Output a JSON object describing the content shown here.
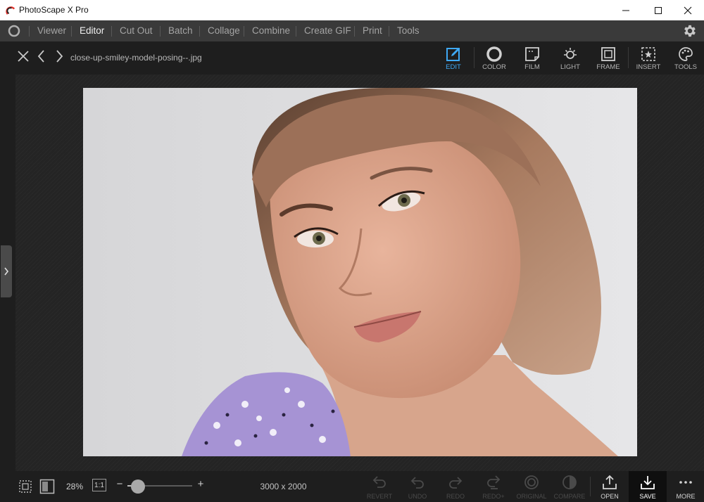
{
  "window": {
    "title": "PhotoScape X Pro",
    "controls": [
      "minimize-icon",
      "maximize-icon",
      "close-icon"
    ]
  },
  "menu": {
    "items": [
      {
        "label": "Viewer",
        "active": false
      },
      {
        "label": "Editor",
        "active": true
      },
      {
        "label": "Cut Out",
        "active": false
      },
      {
        "label": "Batch",
        "active": false
      },
      {
        "label": "Collage",
        "active": false
      },
      {
        "label": "Combine",
        "active": false
      },
      {
        "label": "Create GIF",
        "active": false
      },
      {
        "label": "Print",
        "active": false
      },
      {
        "label": "Tools",
        "active": false
      }
    ],
    "settings_icon": "gear-icon"
  },
  "toolbar": {
    "filename": "close-up-smiley-model-posing--.jpg",
    "nav_icons": [
      "close-icon",
      "chevron-left-icon",
      "chevron-right-icon"
    ],
    "tools": [
      {
        "label": "EDIT",
        "icon": "edit-icon",
        "active": true
      },
      {
        "label": "COLOR",
        "icon": "color-icon",
        "active": false
      },
      {
        "label": "FILM",
        "icon": "film-icon",
        "active": false
      },
      {
        "label": "LIGHT",
        "icon": "light-icon",
        "active": false
      },
      {
        "label": "FRAME",
        "icon": "frame-icon",
        "active": false
      },
      {
        "label": "INSERT",
        "icon": "insert-icon",
        "active": false
      },
      {
        "label": "TOOLS",
        "icon": "palette-icon",
        "active": false
      }
    ]
  },
  "bottom": {
    "zoom_percent": "28%",
    "one_to_one": "1:1",
    "zoom_minus": "−",
    "zoom_plus": "+",
    "dimensions": "3000 x 2000",
    "history": [
      {
        "label": "REVERT",
        "icon": "revert-icon",
        "enabled": false
      },
      {
        "label": "UNDO",
        "icon": "undo-icon",
        "enabled": false
      },
      {
        "label": "REDO",
        "icon": "redo-icon",
        "enabled": false
      },
      {
        "label": "REDO+",
        "icon": "redo-plus-icon",
        "enabled": false
      },
      {
        "label": "ORIGINAL",
        "icon": "original-icon",
        "enabled": false
      },
      {
        "label": "COMPARE",
        "icon": "compare-icon",
        "enabled": false
      }
    ],
    "actions": [
      {
        "label": "OPEN",
        "icon": "upload-icon"
      },
      {
        "label": "SAVE",
        "icon": "download-icon"
      },
      {
        "label": "MORE",
        "icon": "more-icon"
      }
    ]
  },
  "colors": {
    "accent": "#3fa9f5",
    "menubar": "#3a3a3a",
    "background": "#1e1e1e"
  }
}
